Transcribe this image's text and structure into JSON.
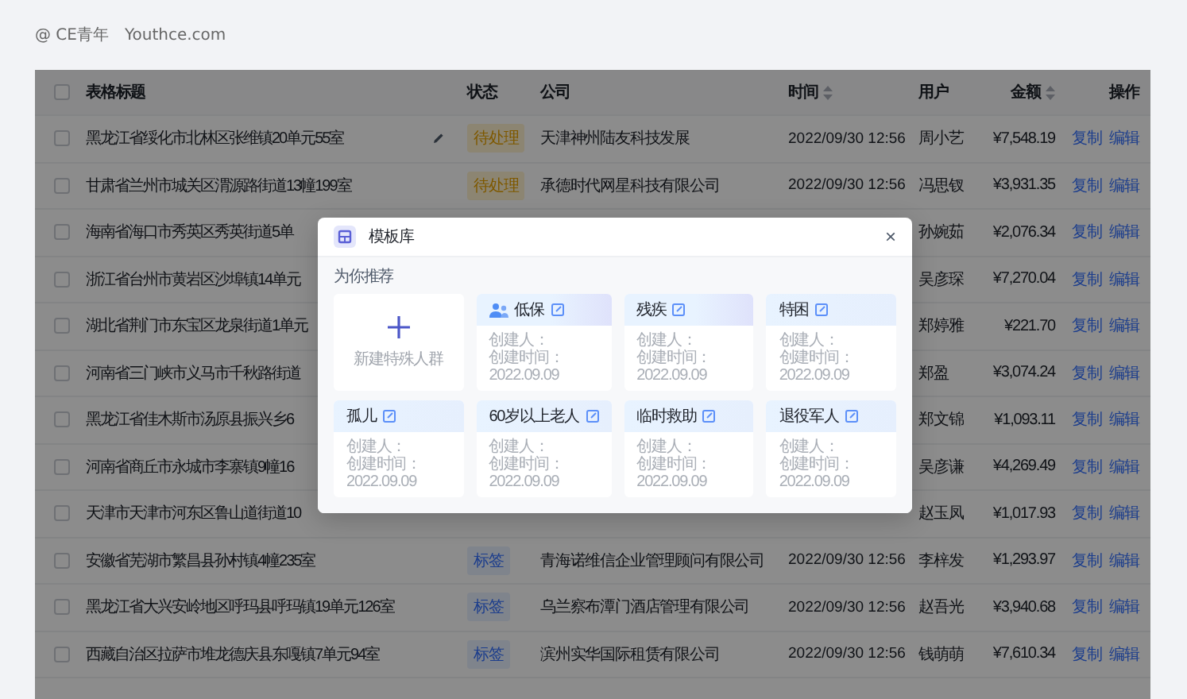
{
  "brand": {
    "mark": "@",
    "name": "CE青年",
    "site": "Youthce.com"
  },
  "table": {
    "select_all_checked": false,
    "columns": [
      {
        "label": "表格标题"
      },
      {
        "label": "状态"
      },
      {
        "label": "公司"
      },
      {
        "label": "时间",
        "sortable": true
      },
      {
        "label": "用户"
      },
      {
        "label": "金额",
        "sortable": true
      },
      {
        "label": "操作"
      }
    ],
    "rows": [
      {
        "checked": false,
        "title": "黑龙江省绥化市北林区张维镇20单元55室",
        "editable": true,
        "status": {
          "kind": "pending",
          "text": "待处理"
        },
        "company": "天津神州陆友科技发展",
        "time": "2022/09/30 12:56",
        "user": "周小艺",
        "amount": "¥7,548.19",
        "actions": [
          "复制",
          "编辑"
        ]
      },
      {
        "checked": false,
        "title": "甘肃省兰州市城关区渭源路街道13幢199室",
        "status": {
          "kind": "pending",
          "text": "待处理"
        },
        "company": "承德时代网星科技有限公司",
        "time": "2022/09/30 12:56",
        "user": "冯思钗",
        "amount": "¥3,931.35",
        "actions": [
          "复制",
          "编辑"
        ]
      },
      {
        "checked": false,
        "title": "海南省海口市秀英区秀英街道5单",
        "user": "孙婉茹",
        "amount": "¥2,076.34",
        "actions": [
          "复制",
          "编辑"
        ]
      },
      {
        "checked": false,
        "title": "浙江省台州市黄岩区沙埠镇14单元",
        "user": "吴彦琛",
        "amount": "¥7,270.04",
        "actions": [
          "复制",
          "编辑"
        ]
      },
      {
        "checked": false,
        "title": "湖北省荆门市东宝区龙泉街道1单元",
        "user": "郑婷雅",
        "amount": "¥221.70",
        "actions": [
          "复制",
          "编辑"
        ]
      },
      {
        "checked": false,
        "title": "河南省三门峡市义马市千秋路街道",
        "user": "郑盈",
        "amount": "¥3,074.24",
        "actions": [
          "复制",
          "编辑"
        ]
      },
      {
        "checked": false,
        "title": "黑龙江省佳木斯市汤原县振兴乡6",
        "user": "郑文锦",
        "amount": "¥1,093.11",
        "actions": [
          "复制",
          "编辑"
        ]
      },
      {
        "checked": false,
        "title": "河南省商丘市永城市李寨镇9幢16",
        "user": "吴彦谦",
        "amount": "¥4,269.49",
        "actions": [
          "复制",
          "编辑"
        ]
      },
      {
        "checked": false,
        "title": "天津市天津市河东区鲁山道街道10",
        "user": "赵玉凤",
        "amount": "¥1,017.93",
        "actions": [
          "复制",
          "编辑"
        ]
      },
      {
        "checked": false,
        "title": "安徽省芜湖市繁昌县孙村镇4幢235室",
        "status": {
          "kind": "tag",
          "text": "标签"
        },
        "company": "青海诺维信企业管理顾问有限公司",
        "time": "2022/09/30 12:56",
        "user": "李梓发",
        "amount": "¥1,293.97",
        "actions": [
          "复制",
          "编辑"
        ]
      },
      {
        "checked": false,
        "title": "黑龙江省大兴安岭地区呼玛县呼玛镇19单元126室",
        "status": {
          "kind": "tag",
          "text": "标签"
        },
        "company": "乌兰察布潭门酒店管理有限公司",
        "time": "2022/09/30 12:56",
        "user": "赵吾光",
        "amount": "¥3,940.68",
        "actions": [
          "复制",
          "编辑"
        ]
      },
      {
        "checked": false,
        "title": "西藏自治区拉萨市堆龙德庆县东嘎镇7单元94室",
        "status": {
          "kind": "tag",
          "text": "标签"
        },
        "company": "滨州实华国际租赁有限公司",
        "time": "2022/09/30 12:56",
        "user": "钱萌萌",
        "amount": "¥7,610.34",
        "actions": [
          "复制",
          "编辑"
        ]
      }
    ]
  },
  "modal": {
    "title": "模板库",
    "close": "×",
    "section": "为你推荐",
    "cards": [
      {
        "kind": "new",
        "label": "新建特殊人群"
      },
      {
        "kind": "template",
        "title": "低保",
        "creator": "创建人：",
        "created": "创建时间：2022.09.09"
      },
      {
        "kind": "template",
        "title": "残疾",
        "creator": "创建人：",
        "created": "创建时间：2022.09.09"
      },
      {
        "kind": "template",
        "title": "特困",
        "creator": "创建人：",
        "created": "创建时间：2022.09.09"
      },
      {
        "kind": "template",
        "title": "孤儿",
        "creator": "创建人：",
        "created": "创建时间：2022.09.09"
      },
      {
        "kind": "template",
        "title": "60岁以上老人",
        "creator": "创建人：",
        "created": "创建时间：2022.09.09"
      },
      {
        "kind": "template",
        "title": "临时救助",
        "creator": "创建人：",
        "created": "创建时间：2022.09.09"
      },
      {
        "kind": "template",
        "title": "退役军人",
        "creator": "创建人：",
        "created": "创建时间：2022.09.09"
      }
    ]
  }
}
